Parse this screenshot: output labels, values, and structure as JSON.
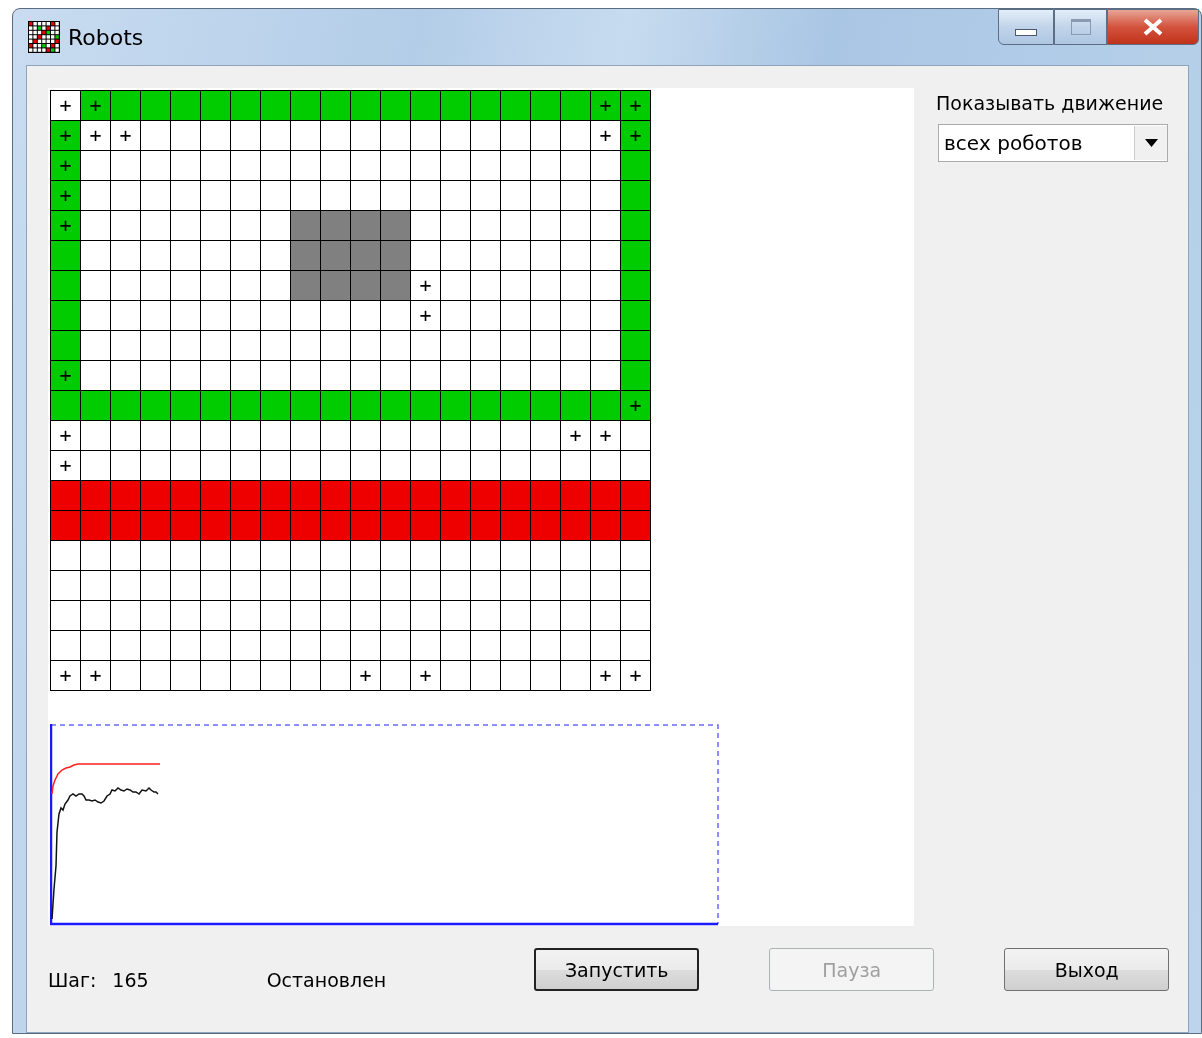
{
  "window": {
    "title": "Robots"
  },
  "grid": {
    "rows": [
      {
        "cells": [
          {
            "kind": "white",
            "text": "+"
          },
          {
            "kind": "green",
            "text": "+"
          },
          {
            "kind": "green"
          },
          {
            "kind": "green"
          },
          {
            "kind": "green"
          },
          {
            "kind": "green"
          },
          {
            "kind": "green"
          },
          {
            "kind": "green"
          },
          {
            "kind": "green"
          },
          {
            "kind": "green"
          },
          {
            "kind": "green"
          },
          {
            "kind": "green"
          },
          {
            "kind": "green"
          },
          {
            "kind": "green"
          },
          {
            "kind": "green"
          },
          {
            "kind": "green"
          },
          {
            "kind": "green"
          },
          {
            "kind": "green"
          },
          {
            "kind": "green",
            "text": "+"
          },
          {
            "kind": "green",
            "text": "+"
          }
        ]
      },
      {
        "cells": [
          {
            "kind": "green",
            "text": "+"
          },
          {
            "kind": "white",
            "text": "+"
          },
          {
            "kind": "white",
            "text": "+"
          },
          {
            "kind": "white"
          },
          {
            "kind": "white"
          },
          {
            "kind": "white"
          },
          {
            "kind": "white"
          },
          {
            "kind": "white"
          },
          {
            "kind": "white"
          },
          {
            "kind": "white"
          },
          {
            "kind": "white"
          },
          {
            "kind": "white"
          },
          {
            "kind": "white"
          },
          {
            "kind": "white"
          },
          {
            "kind": "white"
          },
          {
            "kind": "white"
          },
          {
            "kind": "white"
          },
          {
            "kind": "white"
          },
          {
            "kind": "white",
            "text": "+"
          },
          {
            "kind": "green",
            "text": "+"
          }
        ]
      },
      {
        "cells": [
          {
            "kind": "green",
            "text": "+"
          },
          {
            "kind": "white"
          },
          {
            "kind": "white"
          },
          {
            "kind": "white"
          },
          {
            "kind": "white"
          },
          {
            "kind": "white"
          },
          {
            "kind": "white"
          },
          {
            "kind": "white"
          },
          {
            "kind": "white"
          },
          {
            "kind": "white"
          },
          {
            "kind": "white"
          },
          {
            "kind": "white"
          },
          {
            "kind": "white"
          },
          {
            "kind": "white"
          },
          {
            "kind": "white"
          },
          {
            "kind": "white"
          },
          {
            "kind": "white"
          },
          {
            "kind": "white"
          },
          {
            "kind": "white"
          },
          {
            "kind": "green"
          }
        ]
      },
      {
        "cells": [
          {
            "kind": "green",
            "text": "+"
          },
          {
            "kind": "white"
          },
          {
            "kind": "white"
          },
          {
            "kind": "white"
          },
          {
            "kind": "white"
          },
          {
            "kind": "white"
          },
          {
            "kind": "white"
          },
          {
            "kind": "white"
          },
          {
            "kind": "white"
          },
          {
            "kind": "white"
          },
          {
            "kind": "white"
          },
          {
            "kind": "white"
          },
          {
            "kind": "white"
          },
          {
            "kind": "white"
          },
          {
            "kind": "white"
          },
          {
            "kind": "white"
          },
          {
            "kind": "white"
          },
          {
            "kind": "white"
          },
          {
            "kind": "white"
          },
          {
            "kind": "green"
          }
        ]
      },
      {
        "cells": [
          {
            "kind": "green",
            "text": "+"
          },
          {
            "kind": "white"
          },
          {
            "kind": "white"
          },
          {
            "kind": "white"
          },
          {
            "kind": "white"
          },
          {
            "kind": "white"
          },
          {
            "kind": "white"
          },
          {
            "kind": "white"
          },
          {
            "kind": "gray"
          },
          {
            "kind": "gray"
          },
          {
            "kind": "gray"
          },
          {
            "kind": "gray"
          },
          {
            "kind": "white"
          },
          {
            "kind": "white"
          },
          {
            "kind": "white"
          },
          {
            "kind": "white"
          },
          {
            "kind": "white"
          },
          {
            "kind": "white"
          },
          {
            "kind": "white"
          },
          {
            "kind": "green"
          }
        ]
      },
      {
        "cells": [
          {
            "kind": "green"
          },
          {
            "kind": "white"
          },
          {
            "kind": "white"
          },
          {
            "kind": "white"
          },
          {
            "kind": "white"
          },
          {
            "kind": "white"
          },
          {
            "kind": "white"
          },
          {
            "kind": "white"
          },
          {
            "kind": "gray"
          },
          {
            "kind": "gray"
          },
          {
            "kind": "gray"
          },
          {
            "kind": "gray"
          },
          {
            "kind": "white"
          },
          {
            "kind": "white"
          },
          {
            "kind": "white"
          },
          {
            "kind": "white"
          },
          {
            "kind": "white"
          },
          {
            "kind": "white"
          },
          {
            "kind": "white"
          },
          {
            "kind": "green"
          }
        ]
      },
      {
        "cells": [
          {
            "kind": "green"
          },
          {
            "kind": "white"
          },
          {
            "kind": "white"
          },
          {
            "kind": "white"
          },
          {
            "kind": "white"
          },
          {
            "kind": "white"
          },
          {
            "kind": "white"
          },
          {
            "kind": "white"
          },
          {
            "kind": "gray"
          },
          {
            "kind": "gray"
          },
          {
            "kind": "gray"
          },
          {
            "kind": "gray"
          },
          {
            "kind": "white",
            "text": "+"
          },
          {
            "kind": "white"
          },
          {
            "kind": "white"
          },
          {
            "kind": "white"
          },
          {
            "kind": "white"
          },
          {
            "kind": "white"
          },
          {
            "kind": "white"
          },
          {
            "kind": "green"
          }
        ]
      },
      {
        "cells": [
          {
            "kind": "green"
          },
          {
            "kind": "white"
          },
          {
            "kind": "white"
          },
          {
            "kind": "white"
          },
          {
            "kind": "white"
          },
          {
            "kind": "white"
          },
          {
            "kind": "white"
          },
          {
            "kind": "white"
          },
          {
            "kind": "white"
          },
          {
            "kind": "white"
          },
          {
            "kind": "white"
          },
          {
            "kind": "white"
          },
          {
            "kind": "white",
            "text": "+"
          },
          {
            "kind": "white"
          },
          {
            "kind": "white"
          },
          {
            "kind": "white"
          },
          {
            "kind": "white"
          },
          {
            "kind": "white"
          },
          {
            "kind": "white"
          },
          {
            "kind": "green"
          }
        ]
      },
      {
        "cells": [
          {
            "kind": "green"
          },
          {
            "kind": "white"
          },
          {
            "kind": "white"
          },
          {
            "kind": "white"
          },
          {
            "kind": "white"
          },
          {
            "kind": "white"
          },
          {
            "kind": "white"
          },
          {
            "kind": "white"
          },
          {
            "kind": "white"
          },
          {
            "kind": "white"
          },
          {
            "kind": "white"
          },
          {
            "kind": "white"
          },
          {
            "kind": "white"
          },
          {
            "kind": "white"
          },
          {
            "kind": "white"
          },
          {
            "kind": "white"
          },
          {
            "kind": "white"
          },
          {
            "kind": "white"
          },
          {
            "kind": "white"
          },
          {
            "kind": "green"
          }
        ]
      },
      {
        "cells": [
          {
            "kind": "green",
            "text": "+"
          },
          {
            "kind": "white"
          },
          {
            "kind": "white"
          },
          {
            "kind": "white"
          },
          {
            "kind": "white"
          },
          {
            "kind": "white"
          },
          {
            "kind": "white"
          },
          {
            "kind": "white"
          },
          {
            "kind": "white"
          },
          {
            "kind": "white"
          },
          {
            "kind": "white"
          },
          {
            "kind": "white"
          },
          {
            "kind": "white"
          },
          {
            "kind": "white"
          },
          {
            "kind": "white"
          },
          {
            "kind": "white"
          },
          {
            "kind": "white"
          },
          {
            "kind": "white"
          },
          {
            "kind": "white"
          },
          {
            "kind": "green"
          }
        ]
      },
      {
        "cells": [
          {
            "kind": "green"
          },
          {
            "kind": "green"
          },
          {
            "kind": "green"
          },
          {
            "kind": "green"
          },
          {
            "kind": "green"
          },
          {
            "kind": "green"
          },
          {
            "kind": "green"
          },
          {
            "kind": "green"
          },
          {
            "kind": "green"
          },
          {
            "kind": "green"
          },
          {
            "kind": "green"
          },
          {
            "kind": "green"
          },
          {
            "kind": "green"
          },
          {
            "kind": "green"
          },
          {
            "kind": "green"
          },
          {
            "kind": "green"
          },
          {
            "kind": "green"
          },
          {
            "kind": "green"
          },
          {
            "kind": "green"
          },
          {
            "kind": "green",
            "text": "+"
          }
        ]
      },
      {
        "cells": [
          {
            "kind": "white",
            "text": "+"
          },
          {
            "kind": "white"
          },
          {
            "kind": "white"
          },
          {
            "kind": "white"
          },
          {
            "kind": "white"
          },
          {
            "kind": "white"
          },
          {
            "kind": "white"
          },
          {
            "kind": "white"
          },
          {
            "kind": "white"
          },
          {
            "kind": "white"
          },
          {
            "kind": "white"
          },
          {
            "kind": "white"
          },
          {
            "kind": "white"
          },
          {
            "kind": "white"
          },
          {
            "kind": "white"
          },
          {
            "kind": "white"
          },
          {
            "kind": "white"
          },
          {
            "kind": "white",
            "text": "+"
          },
          {
            "kind": "white",
            "text": "+"
          },
          {
            "kind": "white"
          }
        ]
      },
      {
        "cells": [
          {
            "kind": "white",
            "text": "+"
          },
          {
            "kind": "white"
          },
          {
            "kind": "white"
          },
          {
            "kind": "white"
          },
          {
            "kind": "white"
          },
          {
            "kind": "white"
          },
          {
            "kind": "white"
          },
          {
            "kind": "white"
          },
          {
            "kind": "white"
          },
          {
            "kind": "white"
          },
          {
            "kind": "white"
          },
          {
            "kind": "white"
          },
          {
            "kind": "white"
          },
          {
            "kind": "white"
          },
          {
            "kind": "white"
          },
          {
            "kind": "white"
          },
          {
            "kind": "white"
          },
          {
            "kind": "white"
          },
          {
            "kind": "white"
          },
          {
            "kind": "white"
          }
        ]
      },
      {
        "cells": [
          {
            "kind": "red"
          },
          {
            "kind": "red"
          },
          {
            "kind": "red"
          },
          {
            "kind": "red"
          },
          {
            "kind": "red"
          },
          {
            "kind": "red"
          },
          {
            "kind": "red"
          },
          {
            "kind": "red"
          },
          {
            "kind": "red"
          },
          {
            "kind": "red"
          },
          {
            "kind": "red"
          },
          {
            "kind": "red"
          },
          {
            "kind": "red"
          },
          {
            "kind": "red"
          },
          {
            "kind": "red"
          },
          {
            "kind": "red"
          },
          {
            "kind": "red"
          },
          {
            "kind": "red"
          },
          {
            "kind": "red"
          },
          {
            "kind": "red"
          }
        ]
      },
      {
        "cells": [
          {
            "kind": "red"
          },
          {
            "kind": "red"
          },
          {
            "kind": "red"
          },
          {
            "kind": "red"
          },
          {
            "kind": "red"
          },
          {
            "kind": "red"
          },
          {
            "kind": "red"
          },
          {
            "kind": "red"
          },
          {
            "kind": "red"
          },
          {
            "kind": "red"
          },
          {
            "kind": "red"
          },
          {
            "kind": "red"
          },
          {
            "kind": "red"
          },
          {
            "kind": "red"
          },
          {
            "kind": "red"
          },
          {
            "kind": "red"
          },
          {
            "kind": "red"
          },
          {
            "kind": "red"
          },
          {
            "kind": "red"
          },
          {
            "kind": "red"
          }
        ]
      },
      {
        "cells": [
          {
            "kind": "white"
          },
          {
            "kind": "white"
          },
          {
            "kind": "white"
          },
          {
            "kind": "white"
          },
          {
            "kind": "white"
          },
          {
            "kind": "white"
          },
          {
            "kind": "white"
          },
          {
            "kind": "white"
          },
          {
            "kind": "white"
          },
          {
            "kind": "white"
          },
          {
            "kind": "white"
          },
          {
            "kind": "white"
          },
          {
            "kind": "white"
          },
          {
            "kind": "white"
          },
          {
            "kind": "white"
          },
          {
            "kind": "white"
          },
          {
            "kind": "white"
          },
          {
            "kind": "white"
          },
          {
            "kind": "white"
          },
          {
            "kind": "white"
          }
        ]
      },
      {
        "cells": [
          {
            "kind": "white"
          },
          {
            "kind": "white"
          },
          {
            "kind": "white"
          },
          {
            "kind": "white"
          },
          {
            "kind": "white"
          },
          {
            "kind": "white"
          },
          {
            "kind": "white"
          },
          {
            "kind": "white"
          },
          {
            "kind": "white"
          },
          {
            "kind": "white"
          },
          {
            "kind": "white"
          },
          {
            "kind": "white"
          },
          {
            "kind": "white"
          },
          {
            "kind": "white"
          },
          {
            "kind": "white"
          },
          {
            "kind": "white"
          },
          {
            "kind": "white"
          },
          {
            "kind": "white"
          },
          {
            "kind": "white"
          },
          {
            "kind": "white"
          }
        ]
      },
      {
        "cells": [
          {
            "kind": "white"
          },
          {
            "kind": "white"
          },
          {
            "kind": "white"
          },
          {
            "kind": "white"
          },
          {
            "kind": "white"
          },
          {
            "kind": "white"
          },
          {
            "kind": "white"
          },
          {
            "kind": "white"
          },
          {
            "kind": "white"
          },
          {
            "kind": "white"
          },
          {
            "kind": "white"
          },
          {
            "kind": "white"
          },
          {
            "kind": "white"
          },
          {
            "kind": "white"
          },
          {
            "kind": "white"
          },
          {
            "kind": "white"
          },
          {
            "kind": "white"
          },
          {
            "kind": "white"
          },
          {
            "kind": "white"
          },
          {
            "kind": "white"
          }
        ]
      },
      {
        "cells": [
          {
            "kind": "white"
          },
          {
            "kind": "white"
          },
          {
            "kind": "white"
          },
          {
            "kind": "white"
          },
          {
            "kind": "white"
          },
          {
            "kind": "white"
          },
          {
            "kind": "white"
          },
          {
            "kind": "white"
          },
          {
            "kind": "white"
          },
          {
            "kind": "white"
          },
          {
            "kind": "white"
          },
          {
            "kind": "white"
          },
          {
            "kind": "white"
          },
          {
            "kind": "white"
          },
          {
            "kind": "white"
          },
          {
            "kind": "white"
          },
          {
            "kind": "white"
          },
          {
            "kind": "white"
          },
          {
            "kind": "white"
          },
          {
            "kind": "white"
          }
        ]
      },
      {
        "cells": [
          {
            "kind": "white",
            "text": "+"
          },
          {
            "kind": "white",
            "text": "+"
          },
          {
            "kind": "white"
          },
          {
            "kind": "white"
          },
          {
            "kind": "white"
          },
          {
            "kind": "white"
          },
          {
            "kind": "white"
          },
          {
            "kind": "white"
          },
          {
            "kind": "white"
          },
          {
            "kind": "white"
          },
          {
            "kind": "white",
            "text": "+"
          },
          {
            "kind": "white"
          },
          {
            "kind": "white",
            "text": "+"
          },
          {
            "kind": "white"
          },
          {
            "kind": "white"
          },
          {
            "kind": "white"
          },
          {
            "kind": "white"
          },
          {
            "kind": "white"
          },
          {
            "kind": "white",
            "text": "+"
          },
          {
            "kind": "white",
            "text": "+"
          }
        ]
      }
    ]
  },
  "show_movement": {
    "label": "Показывать движение",
    "value": "всех роботов"
  },
  "status": {
    "step_label": "Шаг:",
    "step": "165",
    "state": "Остановлен"
  },
  "buttons": [
    {
      "label": "Запустить",
      "disabled": false,
      "default": true
    },
    {
      "label": "Пауза",
      "disabled": true,
      "default": false
    },
    {
      "label": "Выход",
      "disabled": false,
      "default": false
    }
  ]
}
